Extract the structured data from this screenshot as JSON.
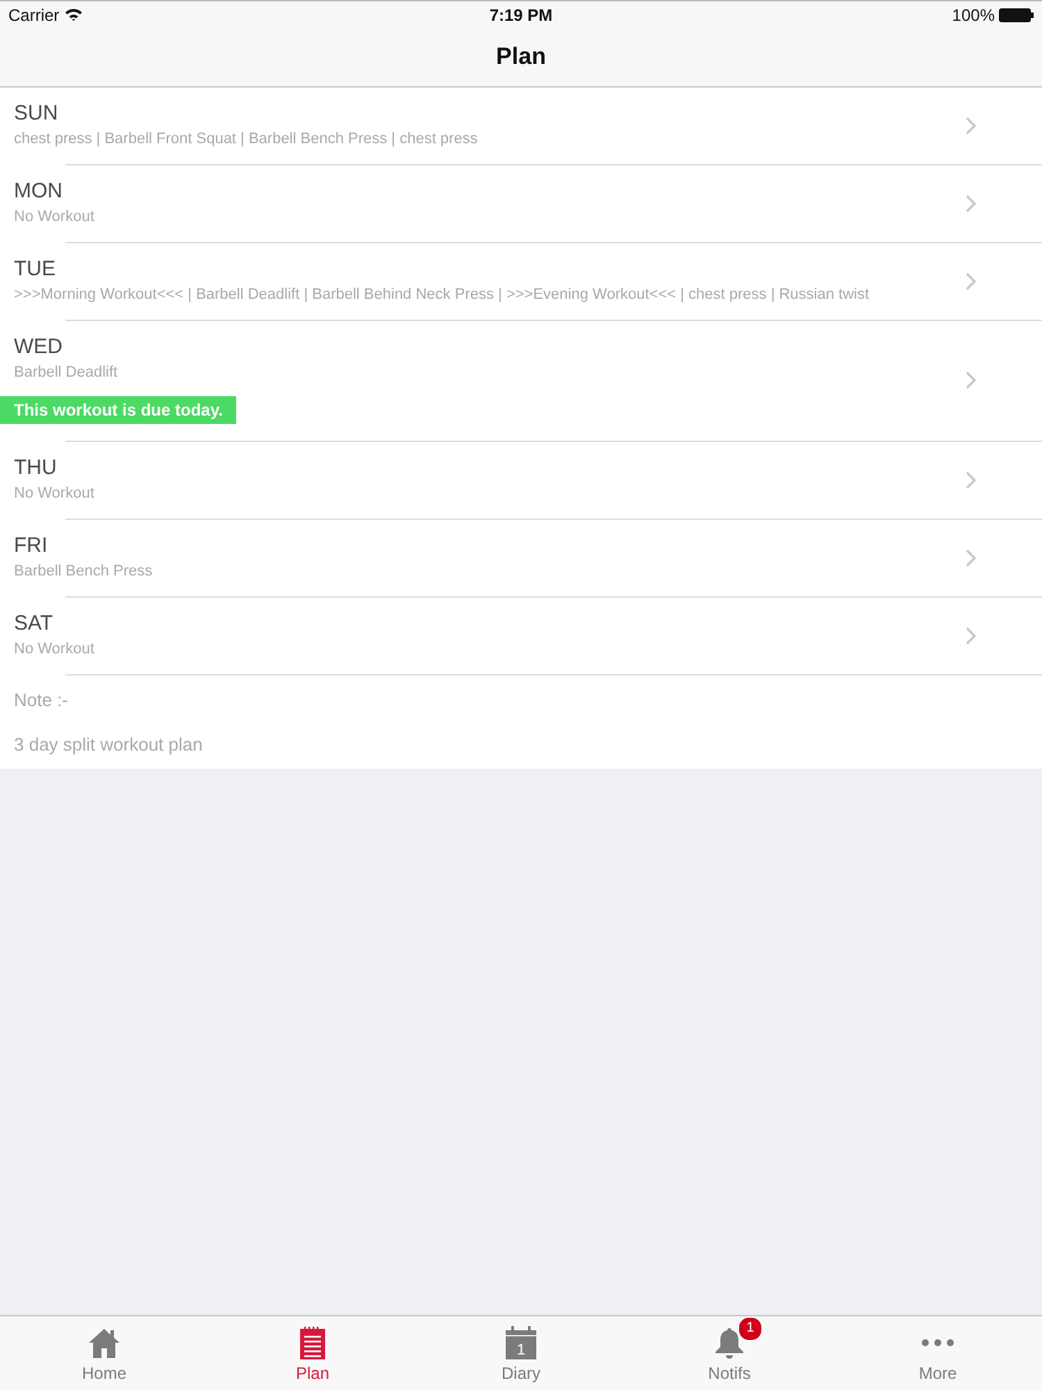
{
  "status_bar": {
    "carrier": "Carrier",
    "time": "7:19 PM",
    "battery": "100%"
  },
  "nav_bar": {
    "title": "Plan"
  },
  "days": [
    {
      "day": "SUN",
      "exercises": "chest press | Barbell Front Squat | Barbell Bench Press | chest press",
      "due": false
    },
    {
      "day": "MON",
      "exercises": "No Workout",
      "due": false
    },
    {
      "day": "TUE",
      "exercises": ">>>Morning Workout<<< | Barbell Deadlift | Barbell Behind Neck Press | >>>Evening Workout<<< | chest press | Russian twist",
      "due": false
    },
    {
      "day": "WED",
      "exercises": "Barbell Deadlift",
      "due": true,
      "due_note": "This workout is due today."
    },
    {
      "day": "THU",
      "exercises": "No Workout",
      "due": false
    },
    {
      "day": "FRI",
      "exercises": "Barbell Bench Press",
      "due": false
    },
    {
      "day": "SAT",
      "exercises": "No Workout",
      "due": false
    }
  ],
  "note": {
    "label": "Note :-",
    "text": "3 day split workout plan"
  },
  "tabs": [
    {
      "kind": "home",
      "label": "Home",
      "selected": false
    },
    {
      "kind": "plan",
      "label": "Plan",
      "selected": true
    },
    {
      "kind": "diary",
      "label": "Diary",
      "selected": false,
      "date": "1"
    },
    {
      "kind": "notifs",
      "label": "Notifs",
      "selected": false,
      "badge": "1"
    },
    {
      "kind": "more",
      "label": "More",
      "selected": false
    }
  ]
}
